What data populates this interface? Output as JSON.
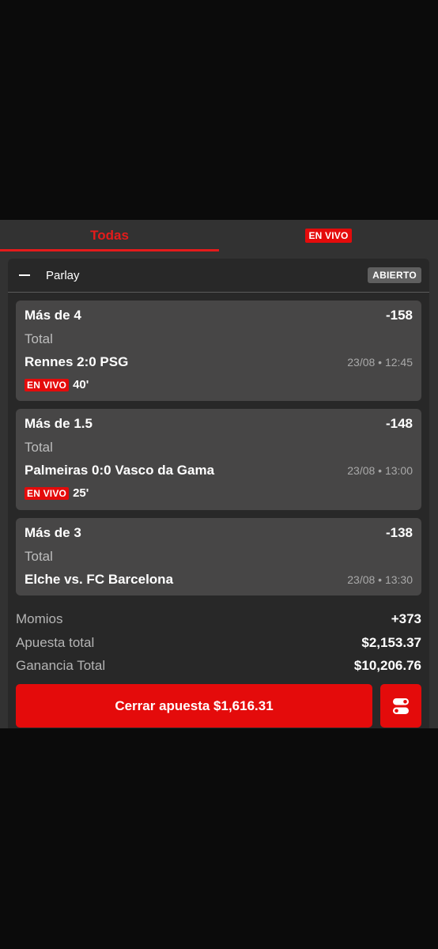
{
  "tabs": {
    "all_label": "Todas",
    "live_label": "EN VIVO"
  },
  "bet": {
    "type_label": "Parlay",
    "status": "ABIERTO"
  },
  "legs": [
    {
      "market": "Más de 4",
      "odds": "-158",
      "bet_type": "Total",
      "match": "Rennes 2:0 PSG",
      "datetime": "23/08 • 12:45",
      "live_label": "EN VIVO",
      "minute": "40'"
    },
    {
      "market": "Más de 1.5",
      "odds": "-148",
      "bet_type": "Total",
      "match": "Palmeiras 0:0 Vasco da Gama",
      "datetime": "23/08 • 13:00",
      "live_label": "EN VIVO",
      "minute": "25'"
    },
    {
      "market": "Más de 3",
      "odds": "-138",
      "bet_type": "Total",
      "match": "Elche vs. FC Barcelona",
      "datetime": "23/08 • 13:30"
    }
  ],
  "summary": {
    "odds_label": "Momios",
    "odds_value": "+373",
    "stake_label": "Apuesta total",
    "stake_value": "$2,153.37",
    "payout_label": "Ganancia Total",
    "payout_value": "$10,206.76"
  },
  "actions": {
    "cashout_label": "Cerrar apuesta $1,616.31",
    "toggle_icon": "toggle-switch-icon"
  },
  "colors": {
    "accent": "#e40b0b",
    "panel_bg": "#323232",
    "card_bg": "#282828",
    "leg_bg": "#474646",
    "page_bg": "#0b0b0b"
  }
}
